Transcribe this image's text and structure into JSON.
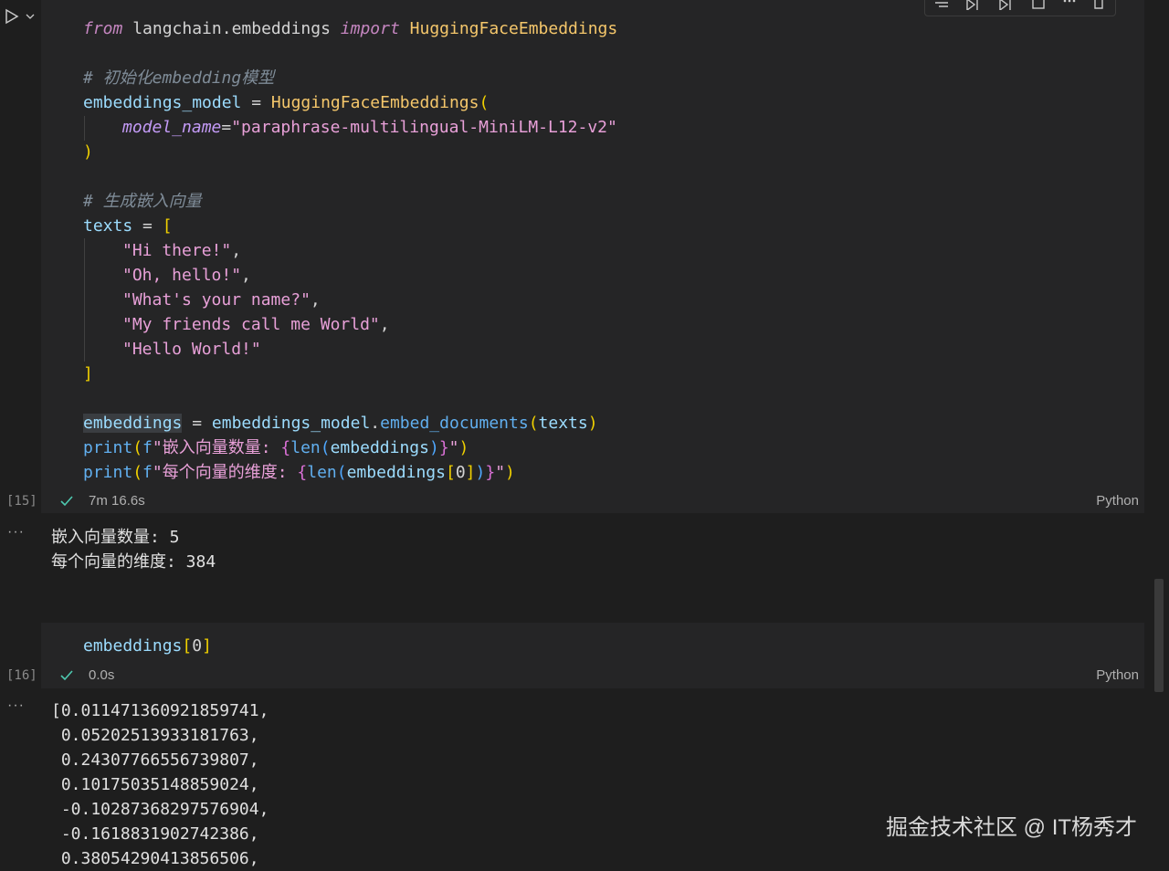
{
  "cell1": {
    "exec_count": "[15]",
    "status_time": "7m 16.6s",
    "language": "Python",
    "code": {
      "l1": {
        "from": "from",
        "mod": " langchain.embeddings ",
        "import": "import",
        "cls": " HuggingFaceEmbeddings"
      },
      "l2": {
        "comment": "# 初始化embedding模型"
      },
      "l3": {
        "var": "embeddings_model",
        "eq": " = ",
        "cls": "HuggingFaceEmbeddings",
        "paren": "("
      },
      "l4": {
        "param": "model_name",
        "eq": "=",
        "str": "\"paraphrase-multilingual-MiniLM-L12-v2\""
      },
      "l5": {
        "paren": ")"
      },
      "l6": {
        "comment": "# 生成嵌入向量"
      },
      "l7": {
        "var": "texts",
        "eq": " = ",
        "brk": "["
      },
      "l8": {
        "str": "\"Hi there!\"",
        "comma": ","
      },
      "l9": {
        "str": "\"Oh, hello!\"",
        "comma": ","
      },
      "l10": {
        "str": "\"What's your name?\"",
        "comma": ","
      },
      "l11": {
        "str": "\"My friends call me World\"",
        "comma": ","
      },
      "l12": {
        "str": "\"Hello World!\""
      },
      "l13": {
        "brk": "]"
      },
      "l14": {
        "var": "embeddings",
        "eq": " = ",
        "obj": "embeddings_model",
        "dot": ".",
        "fn": "embed_documents",
        "p1": "(",
        "arg": "texts",
        "p2": ")"
      },
      "l15": {
        "fn": "print",
        "p1": "(",
        "f": "f",
        "s1": "\"嵌入向量数量: ",
        "b1": "{",
        "fn2": "len",
        "p2": "(",
        "arg": "embeddings",
        "p3": ")",
        "b2": "}",
        "s2": "\"",
        "p4": ")"
      },
      "l16": {
        "fn": "print",
        "p1": "(",
        "f": "f",
        "s1": "\"每个向量的维度: ",
        "b1": "{",
        "fn2": "len",
        "p2": "(",
        "arg": "embeddings",
        "k1": "[",
        "idx": "0",
        "k2": "]",
        "p3": ")",
        "b2": "}",
        "s2": "\"",
        "p4": ")"
      }
    },
    "output": [
      "嵌入向量数量: 5",
      "每个向量的维度: 384"
    ]
  },
  "cell2": {
    "exec_count": "[16]",
    "status_time": "0.0s",
    "language": "Python",
    "code": {
      "var": "embeddings",
      "brk1": "[",
      "idx": "0",
      "brk2": "]"
    },
    "output": [
      "[0.011471360921859741,",
      " 0.05202513933181763,",
      " 0.24307766556739807,",
      " 0.10175035148859024,",
      " -0.10287368297576904,",
      " -0.1618831902742386,",
      " 0.38054290413856506,"
    ]
  },
  "output_more": "···",
  "watermark": "掘金技术社区 @ IT杨秀才",
  "icons": {
    "run": "run-cell-icon",
    "chevron": "chevron-down-icon",
    "check": "check-icon",
    "toolbar": [
      "format-icon",
      "run-above-icon",
      "run-below-icon",
      "split-cell-icon",
      "more-icon",
      "delete-icon"
    ]
  }
}
